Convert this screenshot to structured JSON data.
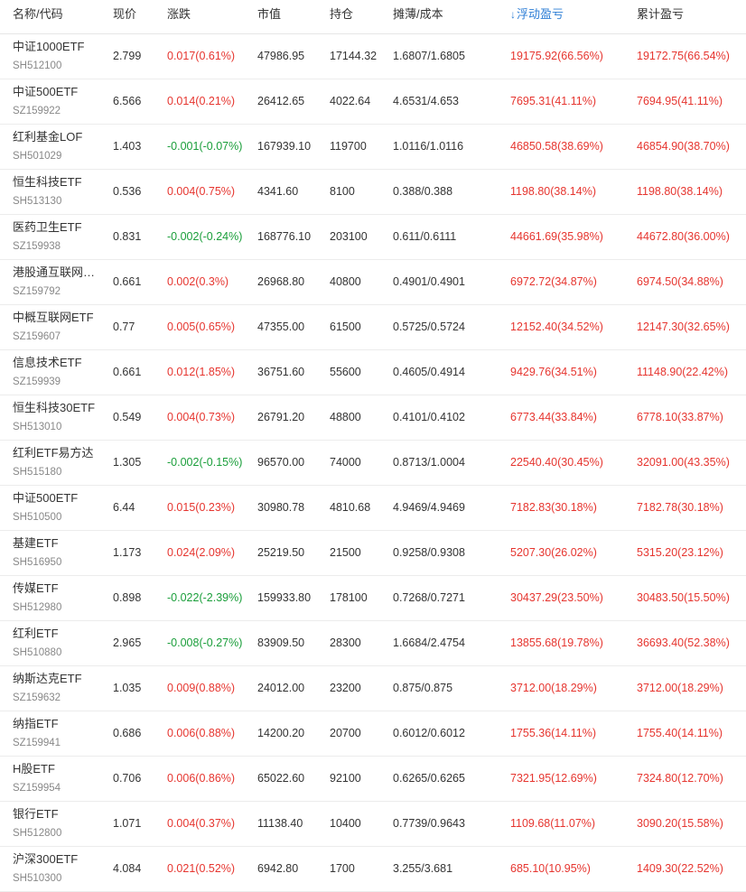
{
  "headers": {
    "name": "名称/代码",
    "price": "现价",
    "change": "涨跌",
    "market_value": "市值",
    "position": "持仓",
    "cost": "摊薄/成本",
    "float_pl": "浮动盈亏",
    "total_pl": "累计盈亏"
  },
  "colors": {
    "up": "#e6352f",
    "down": "#1a9e3a",
    "sort_accent": "#2f7fd6"
  },
  "sort": {
    "column": "float_pl",
    "direction": "desc",
    "icon": "arrow-down-icon"
  },
  "rows": [
    {
      "name": "中证1000ETF",
      "code": "SH512100",
      "price": "2.799",
      "change": "0.017(0.61%)",
      "dir": "up",
      "market_value": "47986.95",
      "position": "17144.32",
      "cost": "1.6807/1.6805",
      "float_pl": "19175.92(66.56%)",
      "total_pl": "19172.75(66.54%)"
    },
    {
      "name": "中证500ETF",
      "code": "SZ159922",
      "price": "6.566",
      "change": "0.014(0.21%)",
      "dir": "up",
      "market_value": "26412.65",
      "position": "4022.64",
      "cost": "4.6531/4.653",
      "float_pl": "7695.31(41.11%)",
      "total_pl": "7694.95(41.11%)"
    },
    {
      "name": "红利基金LOF",
      "code": "SH501029",
      "price": "1.403",
      "change": "-0.001(-0.07%)",
      "dir": "down",
      "market_value": "167939.10",
      "position": "119700",
      "cost": "1.0116/1.0116",
      "float_pl": "46850.58(38.69%)",
      "total_pl": "46854.90(38.70%)"
    },
    {
      "name": "恒生科技ETF",
      "code": "SH513130",
      "price": "0.536",
      "change": "0.004(0.75%)",
      "dir": "up",
      "market_value": "4341.60",
      "position": "8100",
      "cost": "0.388/0.388",
      "float_pl": "1198.80(38.14%)",
      "total_pl": "1198.80(38.14%)"
    },
    {
      "name": "医药卫生ETF",
      "code": "SZ159938",
      "price": "0.831",
      "change": "-0.002(-0.24%)",
      "dir": "down",
      "market_value": "168776.10",
      "position": "203100",
      "cost": "0.611/0.6111",
      "float_pl": "44661.69(35.98%)",
      "total_pl": "44672.80(36.00%)"
    },
    {
      "name": "港股通互联网ETF",
      "code": "SZ159792",
      "price": "0.661",
      "change": "0.002(0.3%)",
      "dir": "up",
      "market_value": "26968.80",
      "position": "40800",
      "cost": "0.4901/0.4901",
      "float_pl": "6972.72(34.87%)",
      "total_pl": "6974.50(34.88%)"
    },
    {
      "name": "中概互联网ETF",
      "code": "SZ159607",
      "price": "0.77",
      "change": "0.005(0.65%)",
      "dir": "up",
      "market_value": "47355.00",
      "position": "61500",
      "cost": "0.5725/0.5724",
      "float_pl": "12152.40(34.52%)",
      "total_pl": "12147.30(32.65%)"
    },
    {
      "name": "信息技术ETF",
      "code": "SZ159939",
      "price": "0.661",
      "change": "0.012(1.85%)",
      "dir": "up",
      "market_value": "36751.60",
      "position": "55600",
      "cost": "0.4605/0.4914",
      "float_pl": "9429.76(34.51%)",
      "total_pl": "11148.90(22.42%)"
    },
    {
      "name": "恒生科技30ETF",
      "code": "SH513010",
      "price": "0.549",
      "change": "0.004(0.73%)",
      "dir": "up",
      "market_value": "26791.20",
      "position": "48800",
      "cost": "0.4101/0.4102",
      "float_pl": "6773.44(33.84%)",
      "total_pl": "6778.10(33.87%)"
    },
    {
      "name": "红利ETF易方达",
      "code": "SH515180",
      "price": "1.305",
      "change": "-0.002(-0.15%)",
      "dir": "down",
      "market_value": "96570.00",
      "position": "74000",
      "cost": "0.8713/1.0004",
      "float_pl": "22540.40(30.45%)",
      "total_pl": "32091.00(43.35%)"
    },
    {
      "name": "中证500ETF",
      "code": "SH510500",
      "price": "6.44",
      "change": "0.015(0.23%)",
      "dir": "up",
      "market_value": "30980.78",
      "position": "4810.68",
      "cost": "4.9469/4.9469",
      "float_pl": "7182.83(30.18%)",
      "total_pl": "7182.78(30.18%)"
    },
    {
      "name": "基建ETF",
      "code": "SH516950",
      "price": "1.173",
      "change": "0.024(2.09%)",
      "dir": "up",
      "market_value": "25219.50",
      "position": "21500",
      "cost": "0.9258/0.9308",
      "float_pl": "5207.30(26.02%)",
      "total_pl": "5315.20(23.12%)"
    },
    {
      "name": "传媒ETF",
      "code": "SH512980",
      "price": "0.898",
      "change": "-0.022(-2.39%)",
      "dir": "down",
      "market_value": "159933.80",
      "position": "178100",
      "cost": "0.7268/0.7271",
      "float_pl": "30437.29(23.50%)",
      "total_pl": "30483.50(15.50%)"
    },
    {
      "name": "红利ETF",
      "code": "SH510880",
      "price": "2.965",
      "change": "-0.008(-0.27%)",
      "dir": "down",
      "market_value": "83909.50",
      "position": "28300",
      "cost": "1.6684/2.4754",
      "float_pl": "13855.68(19.78%)",
      "total_pl": "36693.40(52.38%)"
    },
    {
      "name": "纳斯达克ETF",
      "code": "SZ159632",
      "price": "1.035",
      "change": "0.009(0.88%)",
      "dir": "up",
      "market_value": "24012.00",
      "position": "23200",
      "cost": "0.875/0.875",
      "float_pl": "3712.00(18.29%)",
      "total_pl": "3712.00(18.29%)"
    },
    {
      "name": "纳指ETF",
      "code": "SZ159941",
      "price": "0.686",
      "change": "0.006(0.88%)",
      "dir": "up",
      "market_value": "14200.20",
      "position": "20700",
      "cost": "0.6012/0.6012",
      "float_pl": "1755.36(14.11%)",
      "total_pl": "1755.40(14.11%)"
    },
    {
      "name": "H股ETF",
      "code": "SZ159954",
      "price": "0.706",
      "change": "0.006(0.86%)",
      "dir": "up",
      "market_value": "65022.60",
      "position": "92100",
      "cost": "0.6265/0.6265",
      "float_pl": "7321.95(12.69%)",
      "total_pl": "7324.80(12.70%)"
    },
    {
      "name": "银行ETF",
      "code": "SH512800",
      "price": "1.071",
      "change": "0.004(0.37%)",
      "dir": "up",
      "market_value": "11138.40",
      "position": "10400",
      "cost": "0.7739/0.9643",
      "float_pl": "1109.68(11.07%)",
      "total_pl": "3090.20(15.58%)"
    },
    {
      "name": "沪深300ETF",
      "code": "SH510300",
      "price": "4.084",
      "change": "0.021(0.52%)",
      "dir": "up",
      "market_value": "6942.80",
      "position": "1700",
      "cost": "3.255/3.681",
      "float_pl": "685.10(10.95%)",
      "total_pl": "1409.30(22.52%)"
    }
  ]
}
